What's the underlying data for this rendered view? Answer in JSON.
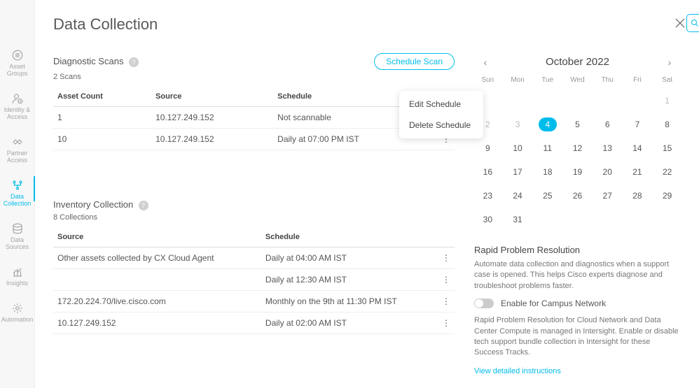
{
  "title": "Data Collection",
  "sidebar": [
    {
      "label": "Asset\nGroups",
      "icon": "circle-list",
      "active": false
    },
    {
      "label": "Identity &\nAccess",
      "icon": "user-check",
      "active": false
    },
    {
      "label": "Partner\nAccess",
      "icon": "handshake",
      "active": false
    },
    {
      "label": "Data\nCollection",
      "icon": "branch",
      "active": true
    },
    {
      "label": "Data\nSources",
      "icon": "stack",
      "active": false
    },
    {
      "label": "Insights",
      "icon": "chart",
      "active": false
    },
    {
      "label": "Automation",
      "icon": "gear-cycle",
      "active": false
    }
  ],
  "diagnostic": {
    "title": "Diagnostic Scans",
    "schedule_btn": "Schedule Scan",
    "count_label": "2 Scans",
    "cols": [
      "Asset Count",
      "Source",
      "Schedule"
    ],
    "rows": [
      {
        "asset_count": "1",
        "source": "10.127.249.152",
        "schedule": "Not scannable"
      },
      {
        "asset_count": "10",
        "source": "10.127.249.152",
        "schedule": "Daily at 07:00 PM IST"
      }
    ],
    "menu": {
      "edit": "Edit Schedule",
      "delete": "Delete Schedule"
    }
  },
  "inventory": {
    "title": "Inventory Collection",
    "count_label": "8 Collections",
    "cols": [
      "Source",
      "Schedule"
    ],
    "rows": [
      {
        "source": "Other assets collected by CX Cloud Agent",
        "schedule": "Daily at 04:00 AM IST"
      },
      {
        "source": "",
        "schedule": "Daily at 12:30 AM IST"
      },
      {
        "source": "172.20.224.70/live.cisco.com",
        "schedule": "Monthly on the 9th at 11:30 PM IST"
      },
      {
        "source": "10.127.249.152",
        "schedule": "Daily at 02:00 AM IST"
      }
    ]
  },
  "calendar": {
    "title": "October 2022",
    "dow": [
      "Sun",
      "Mon",
      "Tue",
      "Wed",
      "Thu",
      "Fri",
      "Sat"
    ],
    "leading_blanks": 6,
    "days": 31,
    "past_until": 3,
    "selected": 4
  },
  "rapid": {
    "title": "Rapid Problem Resolution",
    "desc": "Automate data collection and diagnostics when a support case is opened. This helps Cisco experts diagnose and troubleshoot problems faster.",
    "toggle_label": "Enable for Campus Network",
    "toggle_on": false,
    "fineprint": "Rapid Problem Resolution for Cloud Network and Data Center Compute is managed in Intersight. Enable or disable tech support bundle collection in Intersight for these Success Tracks.",
    "link": "View detailed instructions"
  }
}
